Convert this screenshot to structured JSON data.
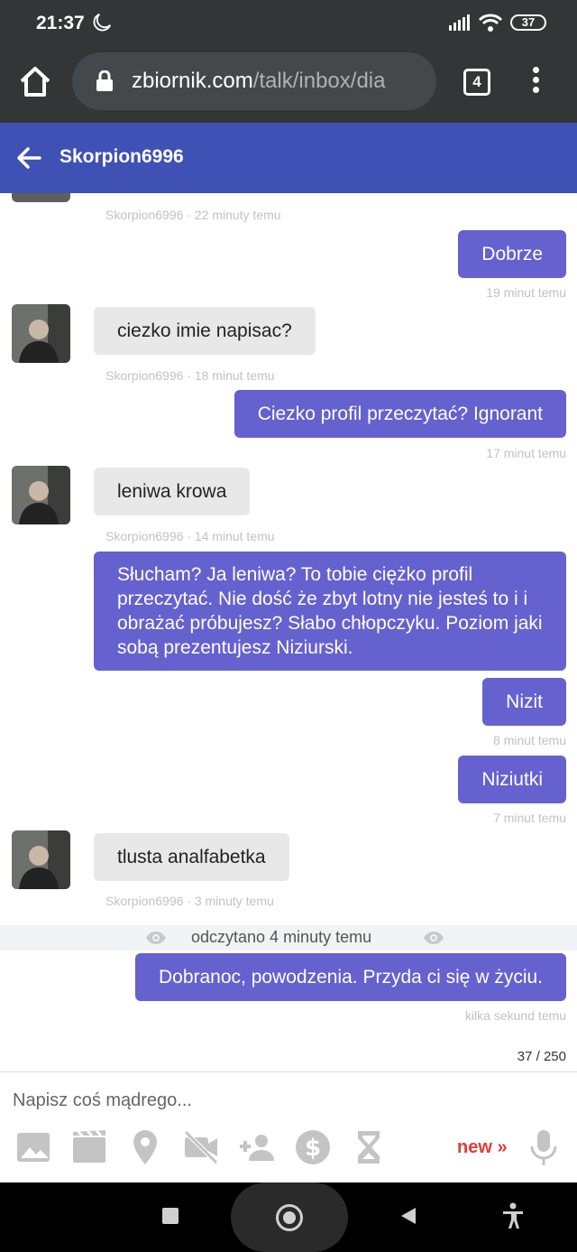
{
  "status_bar": {
    "time": "21:37",
    "battery": "37"
  },
  "browser": {
    "url_host": "zbiornik.com",
    "url_path": "/talk/inbox/dia",
    "tab_count": "4"
  },
  "header": {
    "title": "Skorpion6996"
  },
  "messages": {
    "m0_meta": "Skorpion6996 · 22 minuty temu",
    "m1_text": "Dobrze",
    "m1_meta": "19 minut temu",
    "m2_text": "ciezko imie napisac?",
    "m2_meta": "Skorpion6996 · 18 minut temu",
    "m3_text": "Ciezko profil przeczytać? Ignorant",
    "m3_meta": "17 minut temu",
    "m4_text": "leniwa krowa",
    "m4_meta": "Skorpion6996 · 14 minut temu",
    "m5_text": "Słucham? Ja leniwa? To tobie ciężko profil przeczytać. Nie dość że zbyt lotny nie jesteś to i i obrażać próbujesz? Słabo chłopczyku. Poziom jaki sobą prezentujesz Niziurski.",
    "m6_text": "Nizit",
    "m6_meta": "8 minut temu",
    "m7_text": "Niziutki",
    "m7_meta": "7 minut temu",
    "m8_text": "tlusta analfabetka",
    "m8_meta": "Skorpion6996 · 3 minuty temu",
    "read_receipt": "odczytano 4 minuty temu",
    "m9_text": "Dobranoc, powodzenia. Przyda ci się w życiu.",
    "m9_meta": "kilka sekund temu"
  },
  "composer": {
    "counter": "37 / 250",
    "placeholder": "Napisz coś mądrego...",
    "new_link": "new »"
  },
  "colors": {
    "header": "#3f51b5",
    "outgoing_bubble": "#6561cf",
    "incoming_bubble": "#e8e8e8",
    "new_link": "#e53935"
  },
  "icons": [
    "image-icon",
    "video-icon",
    "location-icon",
    "video-off-icon",
    "add-person-icon",
    "dollar-icon",
    "hourglass-icon",
    "microphone-icon"
  ]
}
